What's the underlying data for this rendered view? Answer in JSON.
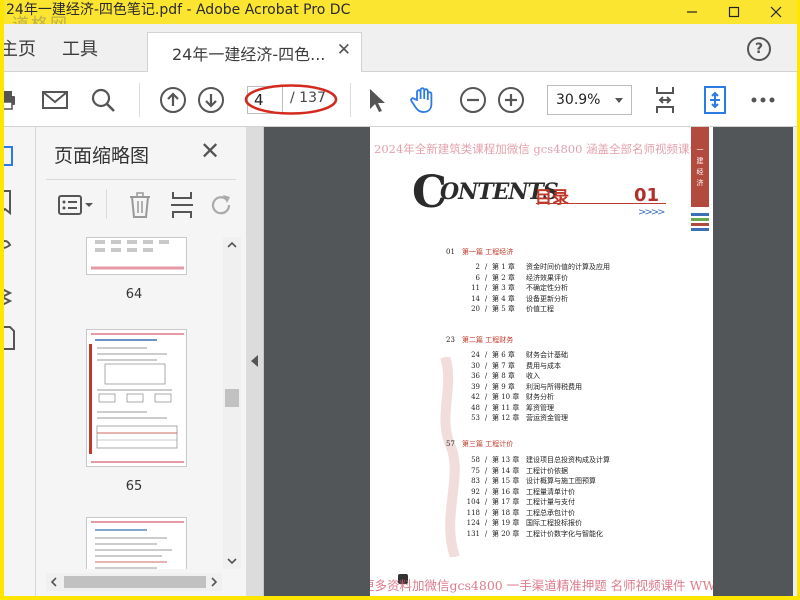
{
  "window": {
    "title": "24年一建经济-四色笔记.pdf - Adobe Acrobat Pro DC",
    "watermark_logo": "道格网"
  },
  "tabs": {
    "home": "主页",
    "tools": "工具",
    "document_tab": "24年一建经济-四色...",
    "close_glyph": "✕",
    "help_glyph": "?"
  },
  "toolbar": {
    "current_page": "4",
    "total_pages": "/ 137",
    "zoom": "30.9%"
  },
  "thumbnails_panel": {
    "title": "页面缩略图",
    "close_glyph": "✕",
    "pages": [
      "64",
      "65"
    ]
  },
  "document": {
    "watermark_top": "2024年全新建筑类课程加微信 gcs4800 涵盖全部名师视频课件",
    "watermark_bottom": "更多资料加微信gcs4800 一手渠道精准押题 名师视频课件 WWW.C",
    "contents_title_big": "C",
    "contents_title_rest": "ONTENTS",
    "contents_title_cn": "目录",
    "contents_number": "01",
    "contents_arrows": ">>>>",
    "ribbon_text": "一建经济",
    "toc": [
      {
        "page": "01",
        "title": "第一篇  工程经济",
        "chapters": [
          {
            "page": "2",
            "chapter": "第 1 章",
            "title": "资金时间价值的计算及应用"
          },
          {
            "page": "6",
            "chapter": "第 2 章",
            "title": "经济效果评价"
          },
          {
            "page": "11",
            "chapter": "第 3 章",
            "title": "不确定性分析"
          },
          {
            "page": "14",
            "chapter": "第 4 章",
            "title": "设备更新分析"
          },
          {
            "page": "20",
            "chapter": "第 5 章",
            "title": "价值工程"
          }
        ]
      },
      {
        "page": "23",
        "title": "第二篇  工程财务",
        "chapters": [
          {
            "page": "24",
            "chapter": "第 6 章",
            "title": "财务会计基础"
          },
          {
            "page": "30",
            "chapter": "第 7 章",
            "title": "费用与成本"
          },
          {
            "page": "36",
            "chapter": "第 8 章",
            "title": "收入"
          },
          {
            "page": "39",
            "chapter": "第 9 章",
            "title": "利润与所得税费用"
          },
          {
            "page": "42",
            "chapter": "第 10 章",
            "title": "财务分析"
          },
          {
            "page": "48",
            "chapter": "第 11 章",
            "title": "筹资管理"
          },
          {
            "page": "53",
            "chapter": "第 12 章",
            "title": "营运资金管理"
          }
        ]
      },
      {
        "page": "57",
        "title": "第三篇  工程计价",
        "chapters": [
          {
            "page": "58",
            "chapter": "第 13 章",
            "title": "建设项目总投资构成及计算"
          },
          {
            "page": "75",
            "chapter": "第 14 章",
            "title": "工程计价依据"
          },
          {
            "page": "83",
            "chapter": "第 15 章",
            "title": "设计概算与施工图预算"
          },
          {
            "page": "92",
            "chapter": "第 16 章",
            "title": "工程量清单计价"
          },
          {
            "page": "104",
            "chapter": "第 17 章",
            "title": "工程计量与支付"
          },
          {
            "page": "118",
            "chapter": "第 18 章",
            "title": "工程总承包计价"
          },
          {
            "page": "124",
            "chapter": "第 19 章",
            "title": "国际工程投标报价"
          },
          {
            "page": "131",
            "chapter": "第 20 章",
            "title": "工程计价数字化与智能化"
          }
        ]
      }
    ]
  },
  "colors": {
    "title_bar": "#fce531",
    "accent_red": "#c0392b",
    "acrobat_blue": "#2c7be5",
    "viewer_bg": "#525659"
  }
}
